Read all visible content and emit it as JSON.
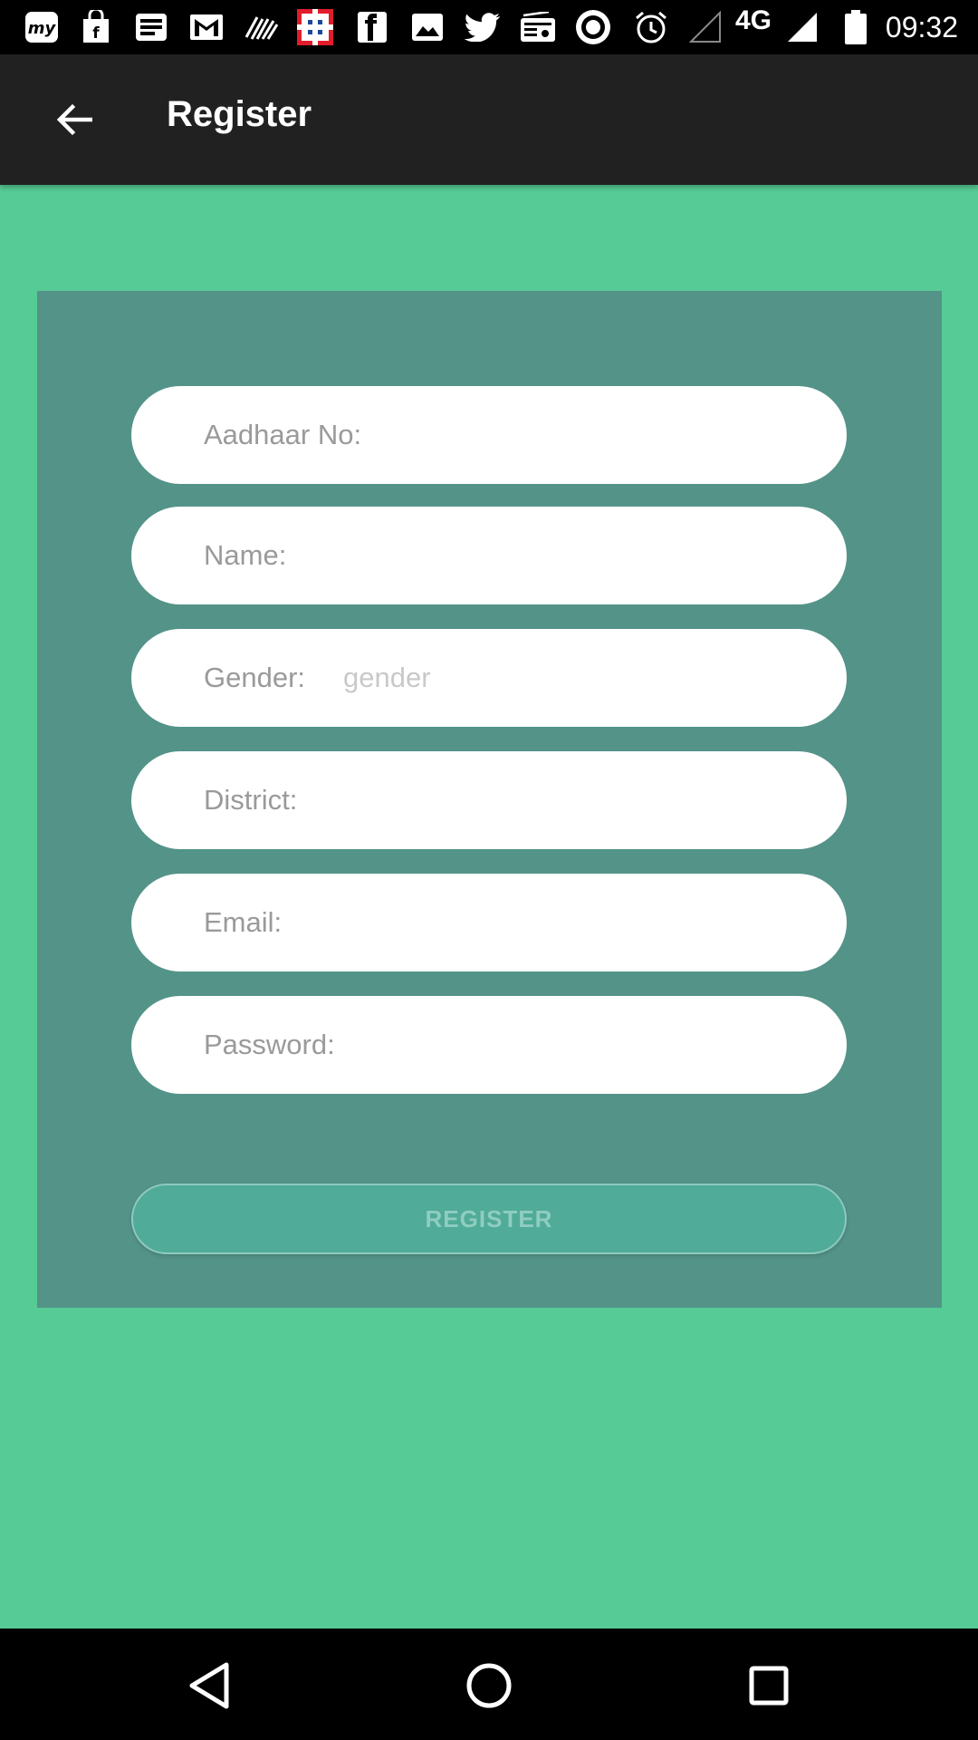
{
  "status_bar": {
    "icons": [
      "myntra-icon",
      "shopping-bag-icon",
      "news-icon",
      "gmail-icon",
      "wave-icon",
      "hdfc-icon",
      "flipkart-icon",
      "image-icon",
      "twitter-icon",
      "radio-icon",
      "record-icon",
      "alarm-icon",
      "signal-empty-icon",
      "signal-full-icon",
      "battery-icon"
    ],
    "network": "4G",
    "time": "09:32"
  },
  "app_bar": {
    "title": "Register"
  },
  "form": {
    "fields": [
      {
        "label": "Aadhaar No:",
        "value": "",
        "placeholder": ""
      },
      {
        "label": "Name:",
        "value": "",
        "placeholder": ""
      },
      {
        "label": "Gender:",
        "value": "",
        "placeholder": "gender"
      },
      {
        "label": "District:",
        "value": "",
        "placeholder": ""
      },
      {
        "label": "Email:",
        "value": "",
        "placeholder": ""
      },
      {
        "label": "Password:",
        "value": "",
        "placeholder": ""
      }
    ],
    "register_label": "REGISTER"
  },
  "colors": {
    "background": "#56cb95",
    "card": "#549388",
    "app_bar": "#212121",
    "button": "#50ab98",
    "button_text": "#8fcdc0"
  }
}
